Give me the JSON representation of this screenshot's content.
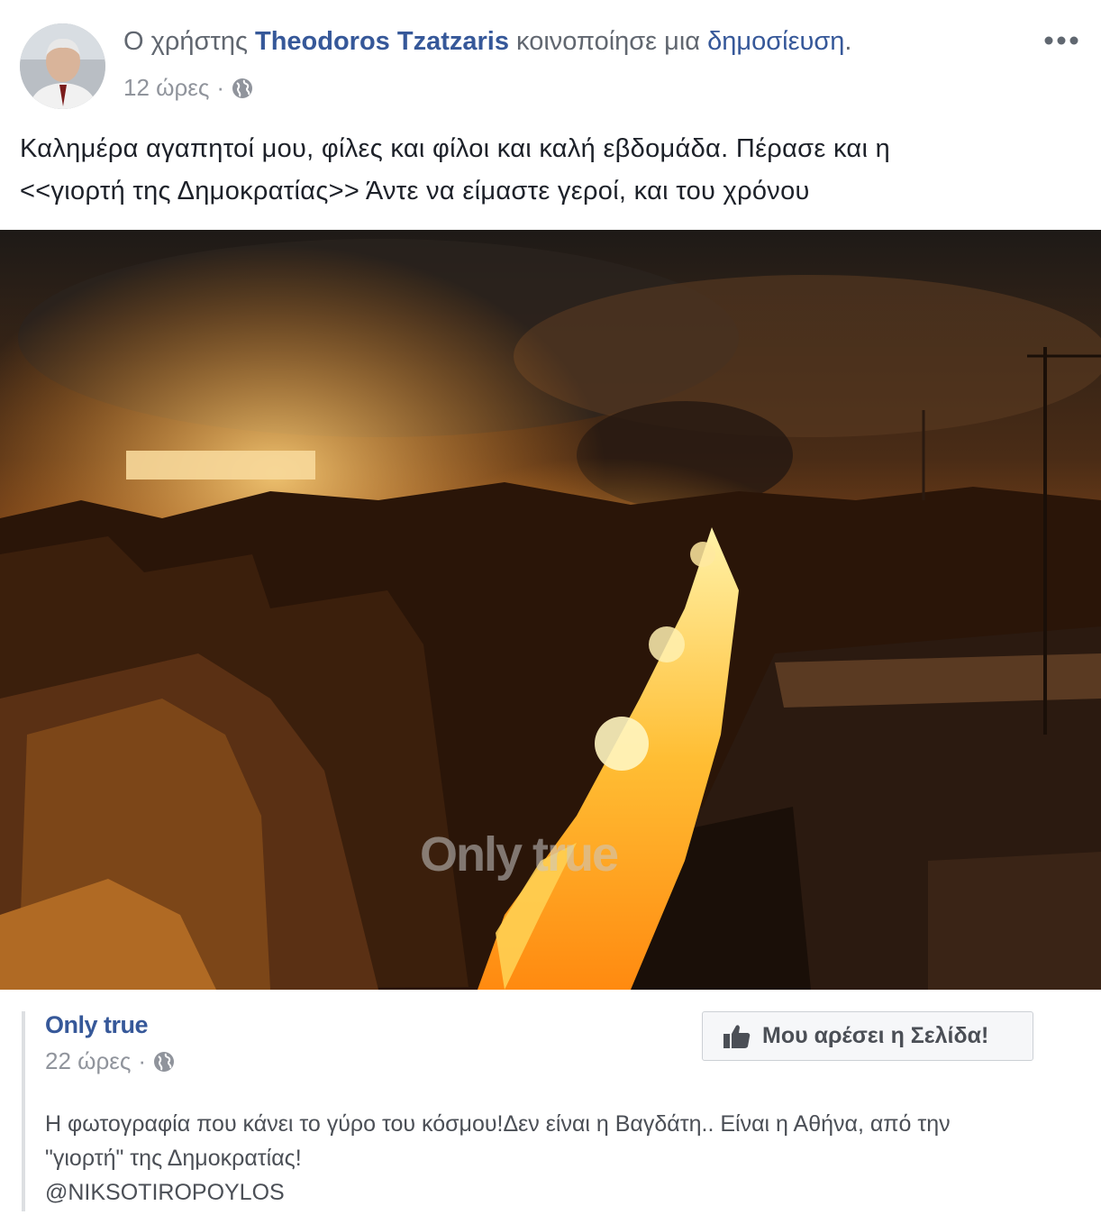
{
  "post": {
    "share_prefix": "Ο χρήστης ",
    "author": "Theodoros Tzatzaris",
    "share_verb": " κοινοποίησε μια ",
    "share_object": "δημοσίευση",
    "share_suffix": ".",
    "time": "12 ώρες",
    "separator": "·",
    "privacy_icon": "globe-icon",
    "menu_icon": "more-options-icon",
    "text_line1": "Καλημέρα αγαπητοί μου, φίλες και φίλοι και καλή εβδομάδα. Πέρασε και η",
    "text_line2": "<<γιορτή της Δημοκρατίας>> Άντε να είμαστε γεροί, και του χρόνου"
  },
  "photo": {
    "watermark": "Only true"
  },
  "shared_post": {
    "page_name": "Only true",
    "time": "22 ώρες",
    "separator": "·",
    "privacy_icon": "globe-icon",
    "like_page_icon": "thumbs-up-icon",
    "like_page_label": "Μου αρέσει η Σελίδα!",
    "text_line1": "Η φωτογραφία που κάνει το γύρο του κόσμου!Δεν είναι η Βαγδάτη.. Είναι η Αθήνα, από την",
    "text_line2": "\"γιορτή\" της Δημοκρατίας!",
    "text_line3": "@NIKSOTIROPOYLOS"
  },
  "colors": {
    "link": "#365899",
    "meta": "#90949c",
    "text": "#1d2129",
    "fire": "#ffb52e"
  }
}
